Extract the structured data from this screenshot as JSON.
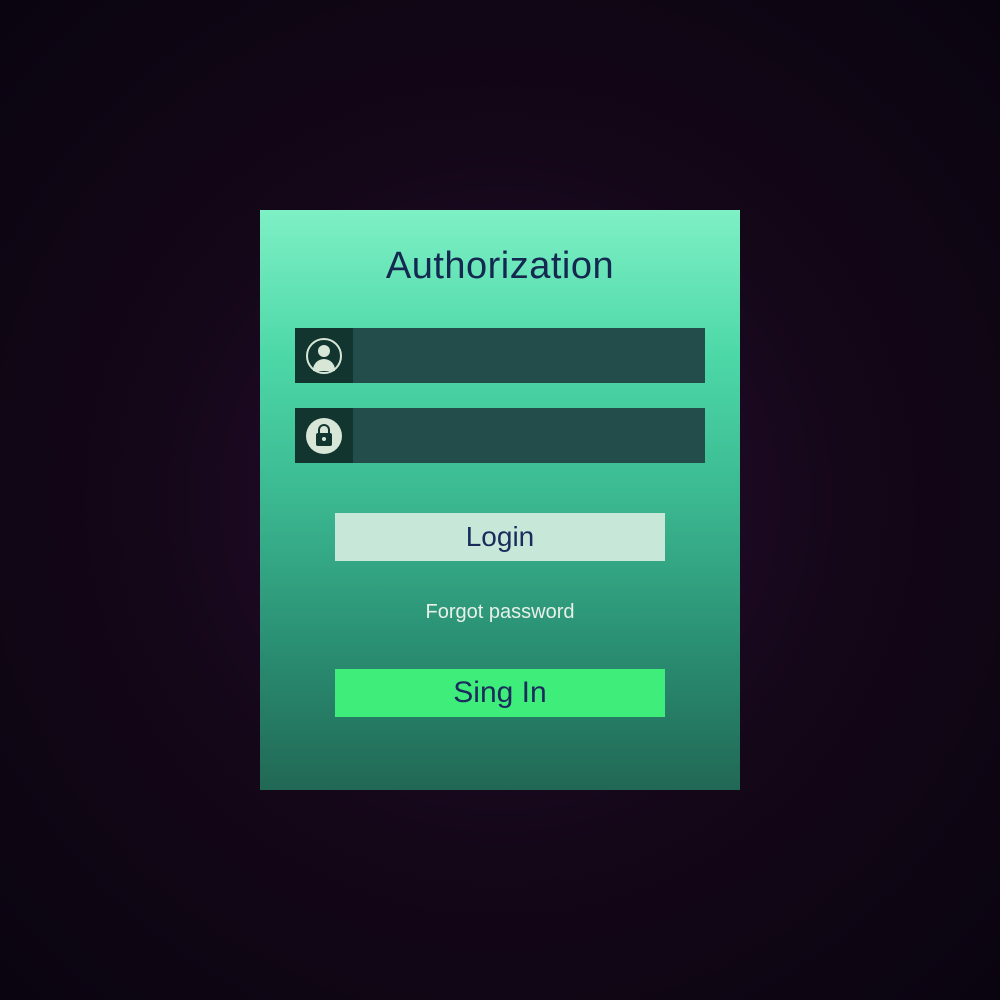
{
  "card": {
    "title": "Authorization",
    "username": {
      "value": "",
      "placeholder": ""
    },
    "password": {
      "value": "",
      "placeholder": ""
    },
    "login_button": "Login",
    "forgot_link": "Forgot password",
    "signin_button": "Sing In"
  }
}
